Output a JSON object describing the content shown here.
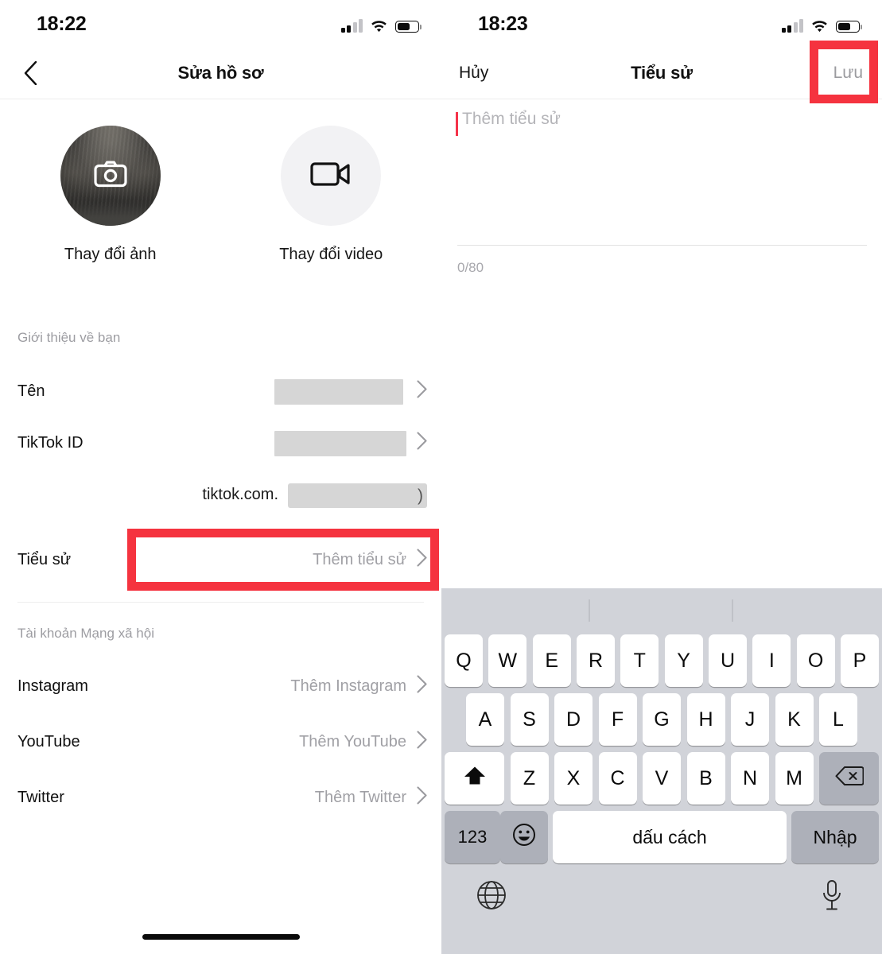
{
  "left_screen": {
    "status_bar": {
      "time": "18:22",
      "signal_icon": "cellular-signal-icon",
      "wifi_icon": "wifi-icon",
      "battery_icon": "battery-icon"
    },
    "nav": {
      "back_icon": "chevron-left-icon",
      "title": "Sửa hồ sơ"
    },
    "media": {
      "photo": {
        "caption": "Thay đổi ảnh",
        "icon": "camera-icon"
      },
      "video": {
        "caption": "Thay đổi video",
        "icon": "video-camera-icon"
      }
    },
    "section_about_label": "Giới thiệu về bạn",
    "rows": [
      {
        "label": "Tên",
        "value": "",
        "redacted": true,
        "chevron": "chevron-right-icon"
      },
      {
        "label": "TikTok ID",
        "value": "",
        "redacted": true,
        "chevron": "chevron-right-icon"
      }
    ],
    "url_row": {
      "prefix": "tiktok.com.",
      "suffix": ")",
      "redacted": true
    },
    "bio_row": {
      "label": "Tiểu sử",
      "value": "Thêm tiểu sử",
      "chevron": "chevron-right-icon"
    },
    "section_social_label": "Tài khoản Mạng xã hội",
    "social_rows": [
      {
        "label": "Instagram",
        "value": "Thêm Instagram",
        "chevron": "chevron-right-icon"
      },
      {
        "label": "YouTube",
        "value": "Thêm YouTube",
        "chevron": "chevron-right-icon"
      },
      {
        "label": "Twitter",
        "value": "Thêm Twitter",
        "chevron": "chevron-right-icon"
      }
    ]
  },
  "right_screen": {
    "status_bar": {
      "time": "18:23",
      "signal_icon": "cellular-signal-icon",
      "wifi_icon": "wifi-icon",
      "battery_icon": "battery-icon"
    },
    "nav": {
      "cancel_label": "Hủy",
      "title": "Tiểu sử",
      "save_label": "Lưu"
    },
    "bio_editor": {
      "placeholder": "Thêm tiểu sử",
      "value": "",
      "counter": "0/80"
    },
    "keyboard": {
      "row1": [
        "Q",
        "W",
        "E",
        "R",
        "T",
        "Y",
        "U",
        "I",
        "O",
        "P"
      ],
      "row2": [
        "A",
        "S",
        "D",
        "F",
        "G",
        "H",
        "J",
        "K",
        "L"
      ],
      "row3": [
        "Z",
        "X",
        "C",
        "V",
        "B",
        "N",
        "M"
      ],
      "shift_icon": "shift-arrow-up-icon",
      "backspace_icon": "backspace-delete-icon",
      "numbers_label": "123",
      "emoji_icon": "emoji-smiley-icon",
      "space_label": "dấu cách",
      "enter_label": "Nhập",
      "globe_icon": "globe-language-icon",
      "mic_icon": "microphone-icon"
    }
  },
  "annotations": {
    "highlight_color": "#f5333f",
    "boxes": [
      {
        "name": "save-button-highlight",
        "target": "Lưu"
      },
      {
        "name": "bio-row-highlight",
        "target": "Thêm tiểu sử"
      }
    ]
  }
}
